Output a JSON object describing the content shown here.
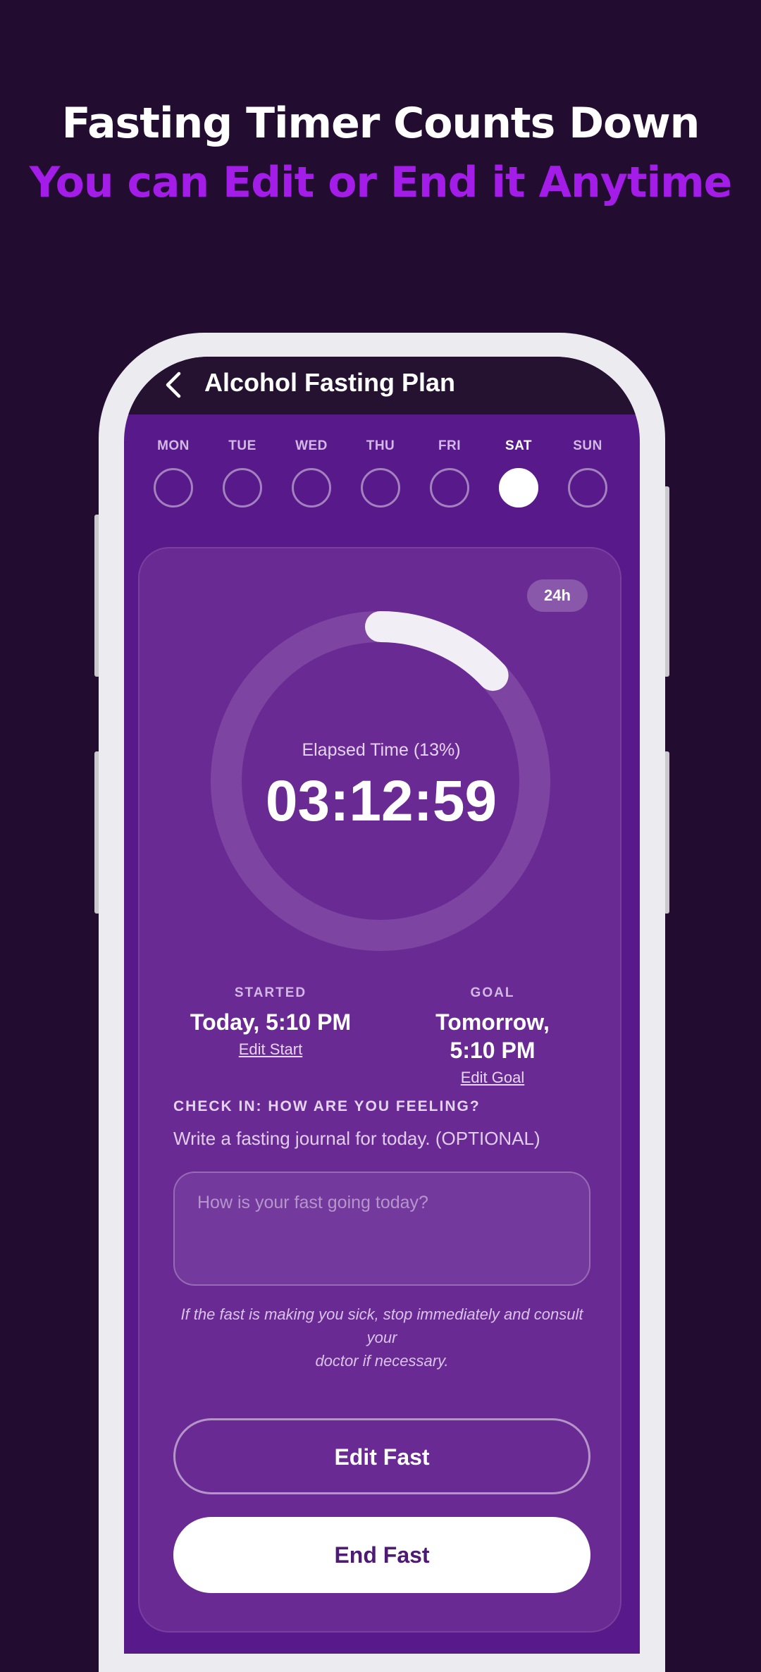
{
  "promo": {
    "headline": "Fasting Timer Counts Down",
    "subheadline": "You can Edit or End it Anytime"
  },
  "appbar": {
    "title": "Alcohol Fasting Plan"
  },
  "days": [
    {
      "label": "MON",
      "active": false
    },
    {
      "label": "TUE",
      "active": false
    },
    {
      "label": "WED",
      "active": false
    },
    {
      "label": "THU",
      "active": false
    },
    {
      "label": "FRI",
      "active": false
    },
    {
      "label": "SAT",
      "active": true
    },
    {
      "label": "SUN",
      "active": false
    }
  ],
  "timer": {
    "duration_badge": "24h",
    "elapsed_label": "Elapsed Time (13%)",
    "elapsed_value": "03:12:59",
    "progress_fraction": 0.13
  },
  "started": {
    "label": "STARTED",
    "value": "Today, 5:10 PM",
    "link": "Edit Start"
  },
  "goal": {
    "label": "GOAL",
    "value": "Tomorrow, 5:10 PM",
    "link": "Edit Goal"
  },
  "checkin": {
    "title": "CHECK IN: HOW ARE YOU FEELING?",
    "subtitle": "Write a fasting journal for today. (OPTIONAL)",
    "placeholder": "How is your fast going today?"
  },
  "warning": {
    "line1": "If the fast is making you sick, stop immediately and consult your",
    "line2": "doctor if necessary."
  },
  "buttons": {
    "edit": "Edit Fast",
    "end": "End Fast"
  },
  "colors": {
    "background": "#220d30",
    "accent": "#a41ce8",
    "screen": "#581a8a",
    "card": "#6a2a93"
  }
}
